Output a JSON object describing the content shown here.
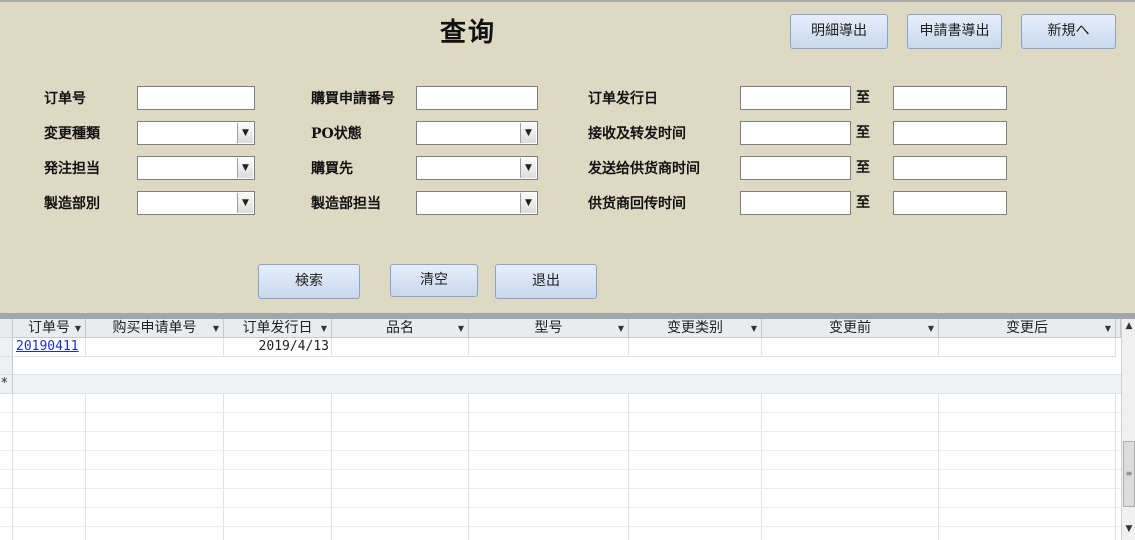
{
  "title": "查询",
  "buttons": {
    "detail_export": "明細導出",
    "request_export": "申請書導出",
    "new": "新規へ",
    "search": "検索",
    "clear": "清空",
    "exit": "退出"
  },
  "labels": {
    "order_no": "订单号",
    "change_type": "変更種類",
    "order_person": "発注担当",
    "mfg_dept": "製造部別",
    "purchase_req_no": "購買申請番号",
    "po_status": "PO状態",
    "purchase_dest": "購買先",
    "mfg_person": "製造部担当",
    "order_issue_date": "订单发行日",
    "receive_forward_time": "接收及转发时间",
    "send_supplier_time": "发送给供货商时间",
    "supplier_return_time": "供货商回传时间",
    "to": "至"
  },
  "grid": {
    "columns": [
      "订单号",
      "购买申请单号",
      "订单发行日",
      "品名",
      "型号",
      "变更类别",
      "变更前",
      "变更后"
    ],
    "rows": [
      [
        "20190411",
        "",
        "2019/4/13",
        "",
        "",
        "",
        "",
        ""
      ]
    ],
    "new_row_marker": "*"
  }
}
